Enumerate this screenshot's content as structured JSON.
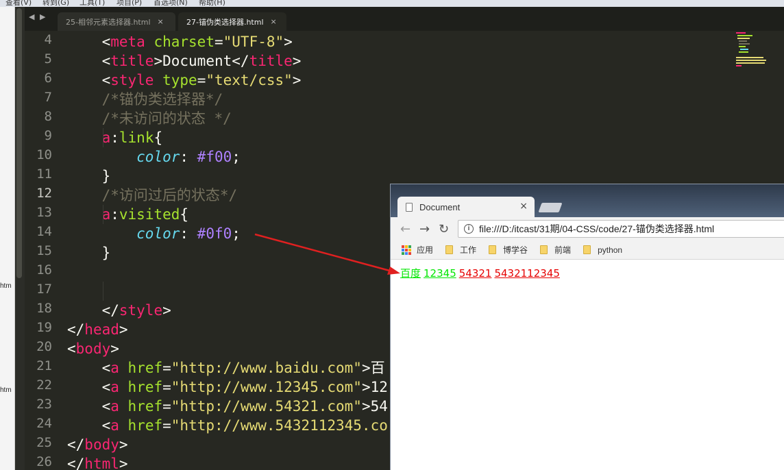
{
  "menubar": {
    "items": [
      "查看(V)",
      "转到(G)",
      "工具(T)",
      "项目(P)",
      "首选项(N)",
      "帮助(H)"
    ]
  },
  "sidebar": {
    "labels": [
      "htm",
      "htm"
    ]
  },
  "tabs": {
    "nav": "◀ ▶",
    "items": [
      {
        "label": "25-相邻元素选择器.html",
        "close": "×",
        "active": false
      },
      {
        "label": "27-锚伪类选择器.html",
        "close": "×",
        "active": true
      }
    ]
  },
  "editor": {
    "current_line": 12,
    "lines": [
      {
        "no": "4",
        "tokens": [
          [
            "t",
            "    "
          ],
          [
            "p",
            "<"
          ],
          [
            "tag",
            "meta"
          ],
          [
            "t",
            " "
          ],
          [
            "attr",
            "charset"
          ],
          [
            "t",
            "="
          ],
          [
            "str",
            "\"UTF-8\""
          ],
          [
            "p",
            ">"
          ]
        ]
      },
      {
        "no": "5",
        "tokens": [
          [
            "t",
            "    "
          ],
          [
            "p",
            "<"
          ],
          [
            "tag",
            "title"
          ],
          [
            "p",
            ">"
          ],
          [
            "t",
            "Document"
          ],
          [
            "p",
            "</"
          ],
          [
            "tag",
            "title"
          ],
          [
            "p",
            ">"
          ]
        ]
      },
      {
        "no": "6",
        "tokens": [
          [
            "t",
            "    "
          ],
          [
            "p",
            "<"
          ],
          [
            "tag",
            "style"
          ],
          [
            "t",
            " "
          ],
          [
            "attr",
            "type"
          ],
          [
            "t",
            "="
          ],
          [
            "str",
            "\"text/css\""
          ],
          [
            "p",
            ">"
          ]
        ]
      },
      {
        "no": "7",
        "tokens": [
          [
            "t",
            "    "
          ],
          [
            "cm",
            "/*锚伪类选择器*/"
          ]
        ]
      },
      {
        "no": "8",
        "tokens": [
          [
            "t",
            "    "
          ],
          [
            "cm",
            "/*未访问的状态 */"
          ]
        ]
      },
      {
        "no": "9",
        "tokens": [
          [
            "t",
            "    "
          ],
          [
            "tag",
            "a"
          ],
          [
            "t",
            ":"
          ],
          [
            "attr",
            "link"
          ],
          [
            "t",
            "{"
          ]
        ]
      },
      {
        "no": "10",
        "tokens": [
          [
            "t",
            "        "
          ],
          [
            "prop",
            "color"
          ],
          [
            "t",
            ": "
          ],
          [
            "val",
            "#f00"
          ],
          [
            "t",
            ";"
          ]
        ]
      },
      {
        "no": "11",
        "tokens": [
          [
            "t",
            "    }"
          ]
        ]
      },
      {
        "no": "12",
        "tokens": [
          [
            "t",
            "    "
          ],
          [
            "cm",
            "/*访问过后的状态*/"
          ]
        ]
      },
      {
        "no": "13",
        "tokens": [
          [
            "t",
            "    "
          ],
          [
            "tag",
            "a"
          ],
          [
            "t",
            ":"
          ],
          [
            "attr",
            "visited"
          ],
          [
            "t",
            "{"
          ]
        ]
      },
      {
        "no": "14",
        "tokens": [
          [
            "t",
            "        "
          ],
          [
            "prop",
            "color"
          ],
          [
            "t",
            ": "
          ],
          [
            "val",
            "#0f0"
          ],
          [
            "t",
            ";"
          ]
        ]
      },
      {
        "no": "15",
        "tokens": [
          [
            "t",
            "    }"
          ]
        ]
      },
      {
        "no": "16",
        "tokens": []
      },
      {
        "no": "17",
        "tokens": []
      },
      {
        "no": "18",
        "tokens": [
          [
            "t",
            "    "
          ],
          [
            "p",
            "</"
          ],
          [
            "tag",
            "style"
          ],
          [
            "p",
            ">"
          ]
        ]
      },
      {
        "no": "19",
        "tokens": [
          [
            "p",
            "</"
          ],
          [
            "tag",
            "head"
          ],
          [
            "p",
            ">"
          ]
        ]
      },
      {
        "no": "20",
        "tokens": [
          [
            "p",
            "<"
          ],
          [
            "tag",
            "body"
          ],
          [
            "p",
            ">"
          ]
        ]
      },
      {
        "no": "21",
        "tokens": [
          [
            "t",
            "    "
          ],
          [
            "p",
            "<"
          ],
          [
            "tag",
            "a"
          ],
          [
            "t",
            " "
          ],
          [
            "attr",
            "href"
          ],
          [
            "t",
            "="
          ],
          [
            "str",
            "\"http://www.baidu.com\""
          ],
          [
            "p",
            ">"
          ],
          [
            "t",
            "百"
          ]
        ]
      },
      {
        "no": "22",
        "tokens": [
          [
            "t",
            "    "
          ],
          [
            "p",
            "<"
          ],
          [
            "tag",
            "a"
          ],
          [
            "t",
            " "
          ],
          [
            "attr",
            "href"
          ],
          [
            "t",
            "="
          ],
          [
            "str",
            "\"http://www.12345.com\""
          ],
          [
            "p",
            ">"
          ],
          [
            "t",
            "12"
          ]
        ]
      },
      {
        "no": "23",
        "tokens": [
          [
            "t",
            "    "
          ],
          [
            "p",
            "<"
          ],
          [
            "tag",
            "a"
          ],
          [
            "t",
            " "
          ],
          [
            "attr",
            "href"
          ],
          [
            "t",
            "="
          ],
          [
            "str",
            "\"http://www.54321.com\""
          ],
          [
            "p",
            ">"
          ],
          [
            "t",
            "54"
          ]
        ]
      },
      {
        "no": "24",
        "tokens": [
          [
            "t",
            "    "
          ],
          [
            "p",
            "<"
          ],
          [
            "tag",
            "a"
          ],
          [
            "t",
            " "
          ],
          [
            "attr",
            "href"
          ],
          [
            "t",
            "="
          ],
          [
            "str",
            "\"http://www.5432112345.co"
          ]
        ]
      },
      {
        "no": "25",
        "tokens": [
          [
            "p",
            "</"
          ],
          [
            "tag",
            "body"
          ],
          [
            "p",
            ">"
          ]
        ]
      },
      {
        "no": "26",
        "tokens": [
          [
            "p",
            "</"
          ],
          [
            "tag",
            "html"
          ],
          [
            "p",
            ">"
          ]
        ]
      }
    ]
  },
  "browser": {
    "tab_title": "Document",
    "tab_close": "×",
    "back": "←",
    "forward": "→",
    "reload": "↻",
    "info": "i",
    "url": "file:///D:/itcast/31期/04-CSS/code/27-锚伪类选择器.html",
    "bookmarks": [
      {
        "label": "应用",
        "type": "apps"
      },
      {
        "label": "工作",
        "type": "folder"
      },
      {
        "label": "博学谷",
        "type": "folder"
      },
      {
        "label": "前端",
        "type": "folder"
      },
      {
        "label": "python",
        "type": "folder"
      }
    ],
    "links": [
      {
        "text": "百度",
        "state": "visited"
      },
      {
        "text": "12345",
        "state": "visited"
      },
      {
        "text": "54321",
        "state": "unvisited"
      },
      {
        "text": "5432112345",
        "state": "unvisited"
      }
    ]
  },
  "colors": {
    "visited": "#00e600",
    "unvisited": "#e60000",
    "arrow": "#e02020"
  }
}
